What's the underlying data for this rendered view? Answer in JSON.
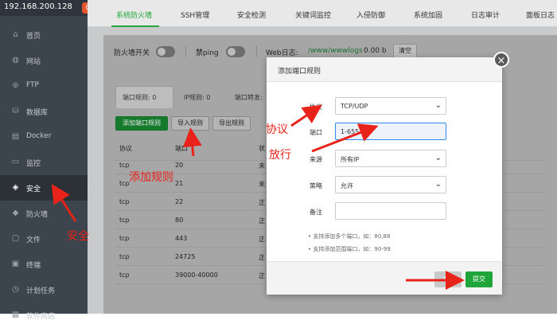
{
  "sidebar": {
    "ip": "192.168.200.128",
    "badge": "0",
    "items": [
      {
        "icon": "home-icon",
        "glyph": "⌂",
        "label": "首页"
      },
      {
        "icon": "globe-icon",
        "glyph": "◍",
        "label": "网站"
      },
      {
        "icon": "ftp-icon",
        "glyph": "⊛",
        "label": "FTP"
      },
      {
        "icon": "database-icon",
        "glyph": "⛁",
        "label": "数据库"
      },
      {
        "icon": "docker-icon",
        "glyph": "▤",
        "label": "Docker"
      },
      {
        "icon": "monitor-icon",
        "glyph": "▭",
        "label": "监控"
      },
      {
        "icon": "shield-icon",
        "glyph": "◈",
        "label": "安全"
      },
      {
        "icon": "firewall-icon",
        "glyph": "◆",
        "label": "防火墙"
      },
      {
        "icon": "folder-icon",
        "glyph": "▢",
        "label": "文件"
      },
      {
        "icon": "terminal-icon",
        "glyph": "▣",
        "label": "终端"
      },
      {
        "icon": "clock-icon",
        "glyph": "◷",
        "label": "计划任务"
      },
      {
        "icon": "store-icon",
        "glyph": "▦",
        "label": "软件商店"
      }
    ]
  },
  "tabs": [
    "系统防火墙",
    "SSH管理",
    "安全检测",
    "关键词监控",
    "入侵防御",
    "系统加固",
    "日志审计",
    "面板日志"
  ],
  "toolbar": {
    "firewall_switch": "防火墙开关",
    "ping_label": "禁ping",
    "weblog_label": "Web日志:",
    "weblog_path": "/www/wwwlogs",
    "weblog_size": "0.00 b",
    "clear_btn": "清空"
  },
  "subtabs": [
    "端口规则: 0",
    "IP规则: 0",
    "端口转发:"
  ],
  "actions": {
    "add": "添加端口规则",
    "import": "导入规则",
    "export": "导出规则"
  },
  "table": {
    "headers": [
      "协议",
      "端口",
      "状"
    ],
    "rows": [
      [
        "tcp",
        "20",
        "未"
      ],
      [
        "tcp",
        "21",
        "未"
      ],
      [
        "tcp",
        "22",
        "正"
      ],
      [
        "tcp",
        "80",
        "正"
      ],
      [
        "tcp",
        "443",
        "正"
      ],
      [
        "tcp",
        "24725",
        "正"
      ],
      [
        "tcp",
        "39000-40000",
        "正"
      ]
    ]
  },
  "modal": {
    "title": "添加端口规则",
    "protocol_label": "协议",
    "protocol_value": "TCP/UDP",
    "port_label": "端口",
    "port_value": "1-65535",
    "source_label": "来源",
    "source_value": "所有IP",
    "strategy_label": "策略",
    "strategy_value": "允许",
    "remark_label": "备注",
    "remark_value": "",
    "notes": [
      "支持添加多个端口，如：80,88",
      "支持添加范围端口，如：90-99"
    ],
    "close_btn": "关闭",
    "submit_btn": "提交"
  },
  "annotations": {
    "protocol": "协议",
    "release": "放行",
    "add_rule": "添加规则",
    "security": "安全"
  },
  "colors": {
    "accent": "#20a53a",
    "annotation": "#e8231a"
  }
}
